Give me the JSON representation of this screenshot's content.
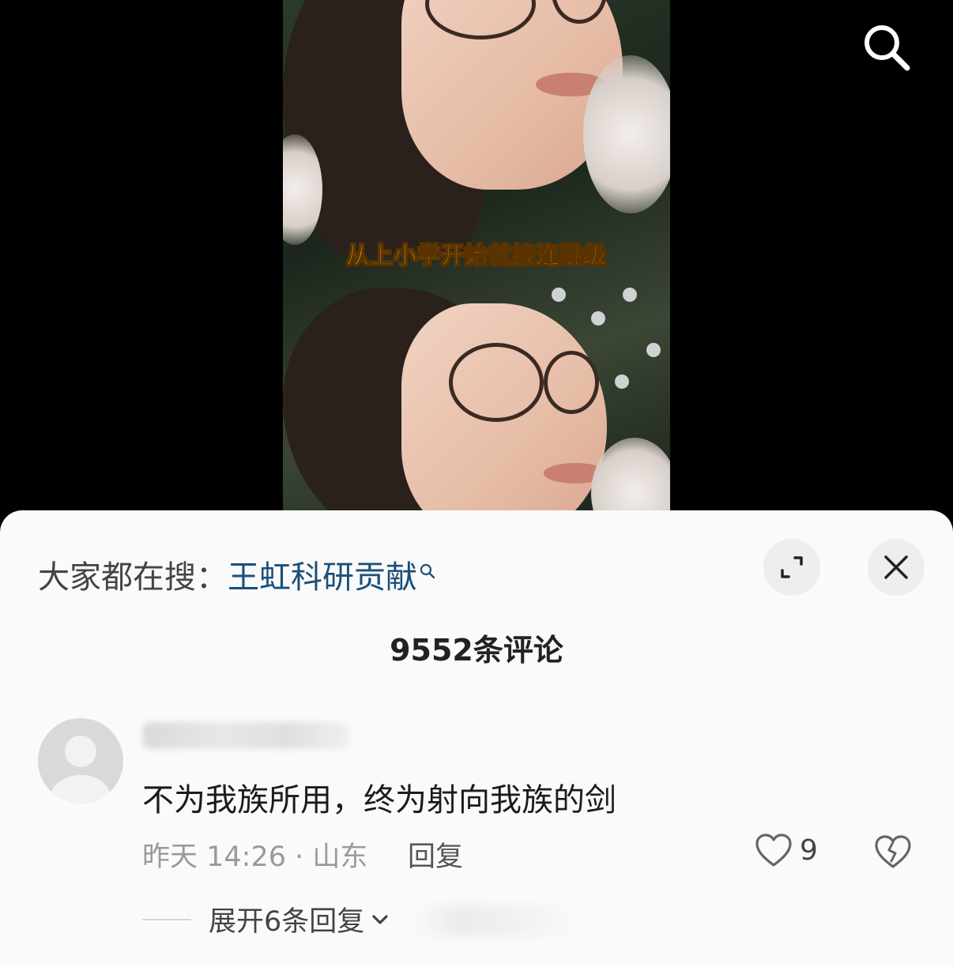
{
  "video": {
    "caption": "从上小学开始就接连跳级"
  },
  "top_bar": {
    "search_icon": "search-icon"
  },
  "sheet": {
    "hot_search_prefix": "大家都在搜：",
    "hot_search_keyword": "王虹科研贡献",
    "expand_icon": "expand-icon",
    "close_icon": "close-icon",
    "comment_count_title": "9552条评论"
  },
  "comment": {
    "avatar_icon": "default-avatar-icon",
    "text": "不为我族所用，终为射向我族的剑",
    "meta": "昨天 14:26 · 山东",
    "reply_label": "回复",
    "like_count": "9",
    "expand_replies_label": "展开6条回复"
  },
  "colors": {
    "keyword": "#1a4f7a",
    "caption_fill": "#ffd33d",
    "sheet_bg": "#fafafa"
  }
}
